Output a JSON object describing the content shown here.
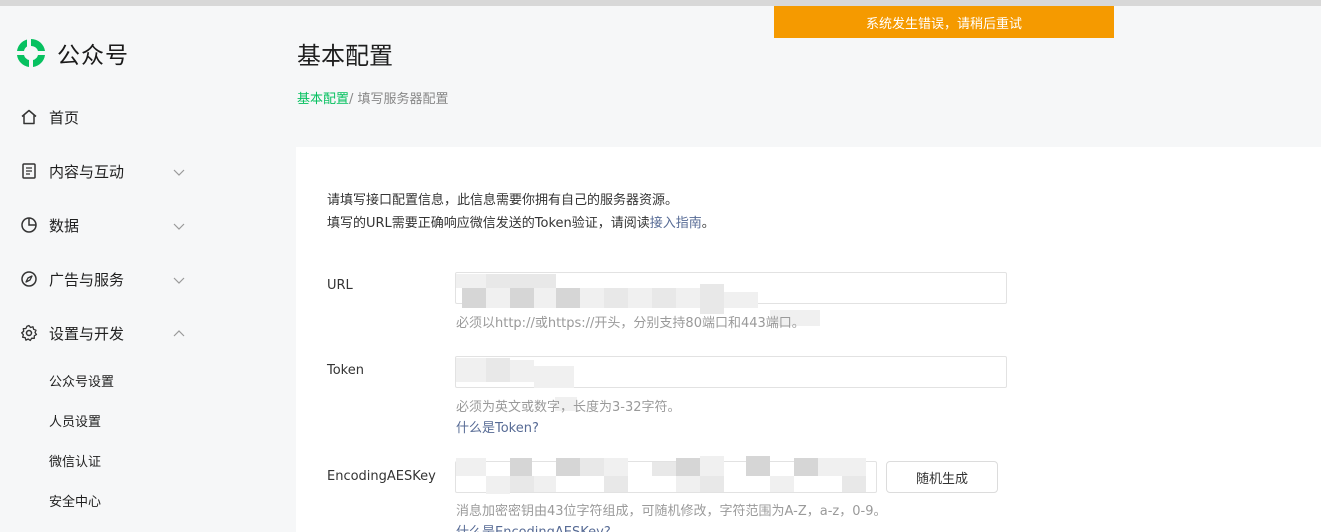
{
  "toast": {
    "text": "系统发生错误，请稍后重试"
  },
  "app": {
    "name": "公众号",
    "brand_color": "#07c160"
  },
  "sidebar": {
    "items": [
      {
        "label": "首页",
        "icon": "home-icon"
      },
      {
        "label": "内容与互动",
        "icon": "document-icon",
        "expanded": false
      },
      {
        "label": "数据",
        "icon": "pie-chart-icon",
        "expanded": false
      },
      {
        "label": "广告与服务",
        "icon": "compass-icon",
        "expanded": false
      },
      {
        "label": "设置与开发",
        "icon": "gear-icon",
        "expanded": true
      }
    ],
    "sub_items": [
      "公众号设置",
      "人员设置",
      "微信认证",
      "安全中心"
    ]
  },
  "page": {
    "title": "基本配置",
    "breadcrumb_link": "基本配置",
    "breadcrumb_rest": "/ 填写服务器配置"
  },
  "intro": {
    "line1": "请填写接口配置信息，此信息需要你拥有自己的服务器资源。",
    "line2_prefix": "填写的URL需要正确响应微信发送的Token验证，请阅读",
    "line2_link": "接入指南",
    "line2_suffix": "。"
  },
  "form": {
    "url": {
      "label": "URL",
      "hint": "必须以http://或https://开头，分别支持80端口和443端口。"
    },
    "token": {
      "label": "Token",
      "hint": "必须为英文或数字，长度为3-32字符。",
      "help": "什么是Token?"
    },
    "aeskey": {
      "label": "EncodingAESKey",
      "hint": "消息加密密钥由43位字符组成，可随机修改，字符范围为A-Z，a-z，0-9。",
      "help": "什么是EncodingAESKey?",
      "button": "随机生成"
    }
  }
}
